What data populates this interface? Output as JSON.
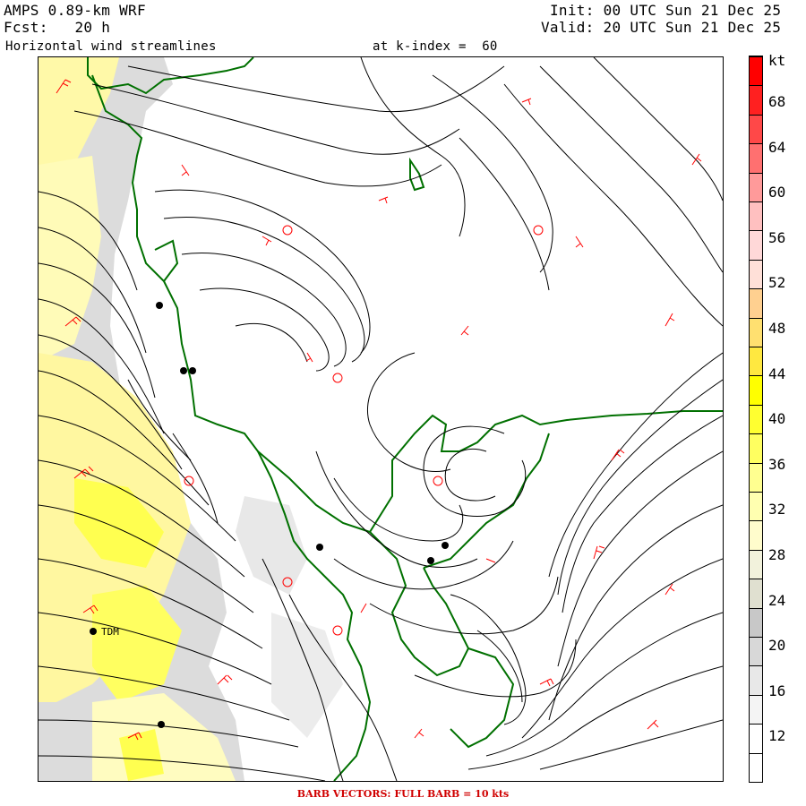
{
  "header": {
    "model": "AMPS 0.89-km WRF",
    "init": "Init: 00 UTC Sun 21 Dec 25",
    "forecast": "Fcst:   20 h",
    "valid": "Valid: 20 UTC Sun 21 Dec 25",
    "field": "Horizontal wind streamlines",
    "level": "at k-index =  60"
  },
  "colorbar": {
    "unit": "kt",
    "tick_labels": [
      "68",
      "64",
      "60",
      "56",
      "52",
      "48",
      "44",
      "40",
      "36",
      "32",
      "28",
      "24",
      "20",
      "16",
      "12"
    ],
    "colors": [
      "#ff0000",
      "#ff2020",
      "#ff4848",
      "#ff7070",
      "#ff9a9a",
      "#ffc0c0",
      "#ffd8d8",
      "#ffe0d8",
      "#ffd090",
      "#ffe070",
      "#ffe840",
      "#ffff00",
      "#ffff30",
      "#ffff60",
      "#ffff90",
      "#ffffb0",
      "#fffccc",
      "#f2f2dc",
      "#e0e0d0",
      "#c8c8c8",
      "#d8d8d8",
      "#e8e8e8",
      "#f4f4f4",
      "#ffffff",
      "#ffffff"
    ]
  },
  "stations": [
    {
      "label": "TDM"
    }
  ],
  "footer": "BARB VECTORS:  FULL BARB = 10 kts",
  "colors": {
    "streamline": "#000000",
    "barb": "#ff0000",
    "coastline": "#007000",
    "speed_shading": [
      "#ffff80",
      "#d8d8d8"
    ]
  }
}
